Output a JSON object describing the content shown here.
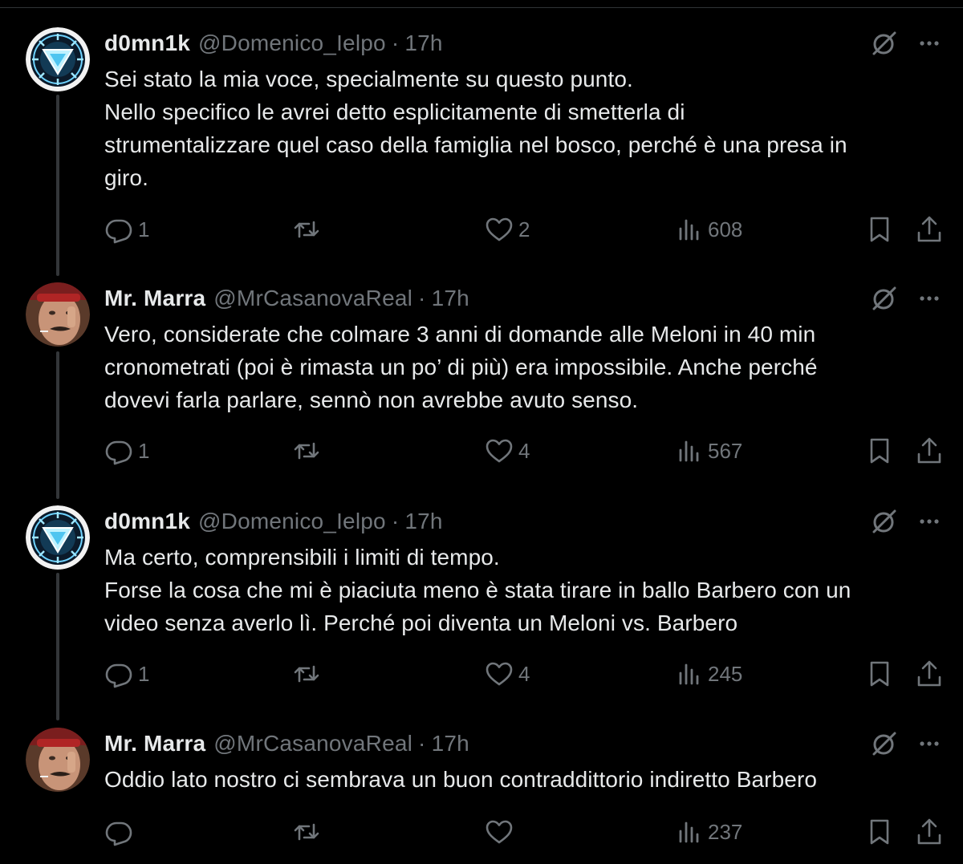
{
  "tweets": [
    {
      "name": "d0mn1k",
      "handle": "@Domenico_Ielpo",
      "separator": "·",
      "time": "17h",
      "avatar": "arc-reactor",
      "lines": [
        "Sei stato la mia voce, specialmente su questo punto.",
        "Nello specifico le avrei detto esplicitamente di smetterla di",
        "strumentalizzare quel caso della famiglia nel bosco, perché è una presa in",
        "giro."
      ],
      "replies": "1",
      "retweets": "",
      "likes": "2",
      "views": "608"
    },
    {
      "name": "Mr. Marra",
      "handle": "@MrCasanovaReal",
      "separator": "·",
      "time": "17h",
      "avatar": "person-photo",
      "lines": [
        "Vero, considerate che colmare 3 anni di domande alle Meloni in 40 min",
        "cronometrati (poi è rimasta un po’ di più) era impossibile. Anche perché",
        "dovevi farla parlare, sennò non avrebbe avuto senso."
      ],
      "replies": "1",
      "retweets": "",
      "likes": "4",
      "views": "567"
    },
    {
      "name": "d0mn1k",
      "handle": "@Domenico_Ielpo",
      "separator": "·",
      "time": "17h",
      "avatar": "arc-reactor",
      "lines": [
        "Ma certo, comprensibili i limiti di tempo.",
        "Forse la cosa che mi è piaciuta meno è stata tirare in ballo Barbero con un",
        "video senza averlo lì. Perché poi diventa un Meloni vs. Barbero"
      ],
      "replies": "1",
      "retweets": "",
      "likes": "4",
      "views": "245"
    },
    {
      "name": "Mr. Marra",
      "handle": "@MrCasanovaReal",
      "separator": "·",
      "time": "17h",
      "avatar": "person-photo",
      "lines": [
        "Oddio lato nostro ci sembrava un buon contraddittorio indiretto Barbero"
      ],
      "replies": "",
      "retweets": "",
      "likes": "",
      "views": "237"
    }
  ],
  "icons": {
    "reply": "reply-icon",
    "retweet": "retweet-icon",
    "like": "heart-icon",
    "views": "views-icon",
    "bookmark": "bookmark-icon",
    "share": "share-icon",
    "grok": "grok-icon",
    "more": "more-icon"
  },
  "colors": {
    "background": "#000000",
    "text": "#e7e9ea",
    "muted": "#71767b",
    "thread_line": "#333639"
  }
}
